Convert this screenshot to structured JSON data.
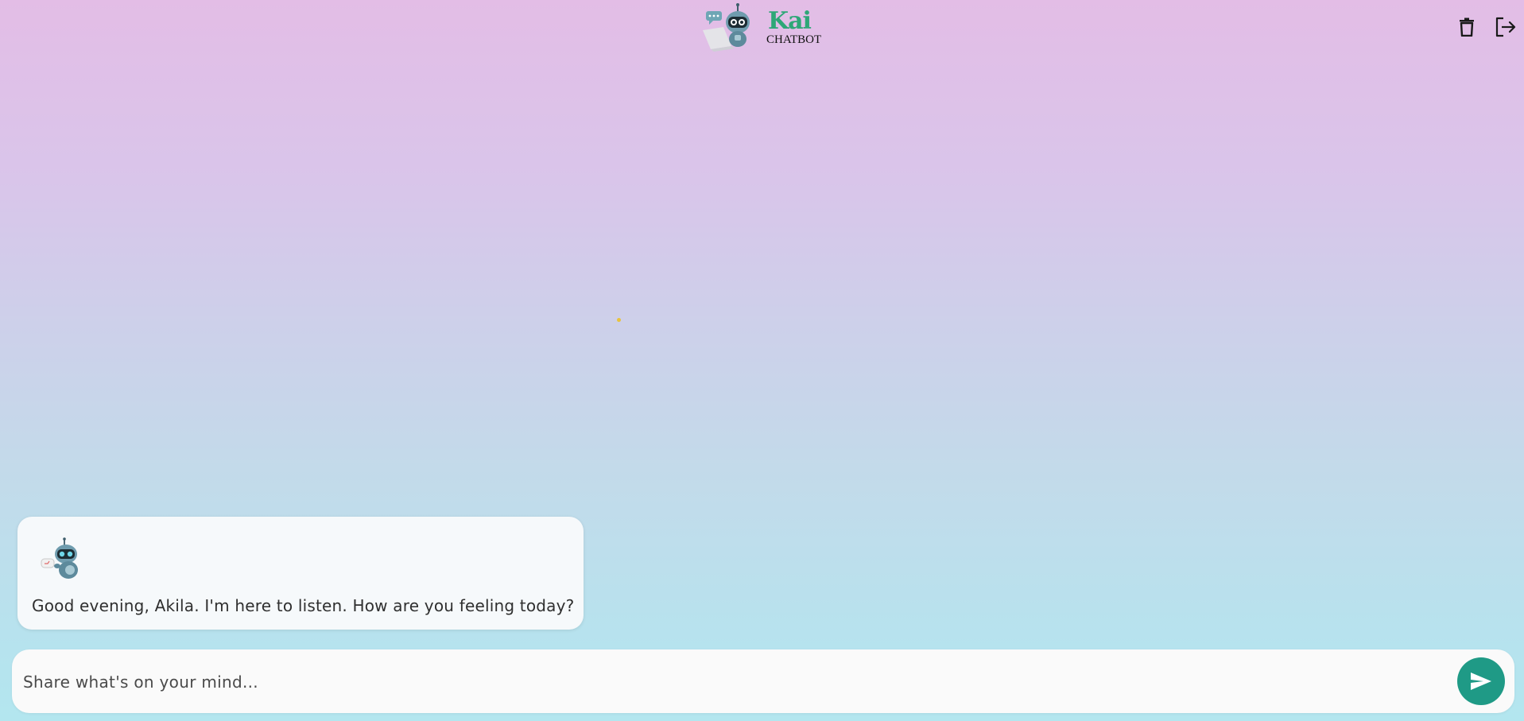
{
  "header": {
    "logo_title": "Kai",
    "logo_subtitle": "CHATBOT",
    "trash_icon": "trash-icon",
    "logout_icon": "logout-icon"
  },
  "messages": [
    {
      "sender": "bot",
      "avatar_icon": "robot-avatar-icon",
      "text": "Good evening, Akila. I'm here to listen. How are you feeling today?"
    }
  ],
  "composer": {
    "value": "",
    "placeholder": "Share what's on your mind...",
    "send_icon": "send-icon"
  },
  "colors": {
    "gradient_top": "#e3bde6",
    "gradient_bottom": "#b3e6ef",
    "brand_green": "#2ea777",
    "send_button": "#1f9a86",
    "bubble_bg": "#f6f9fb"
  }
}
